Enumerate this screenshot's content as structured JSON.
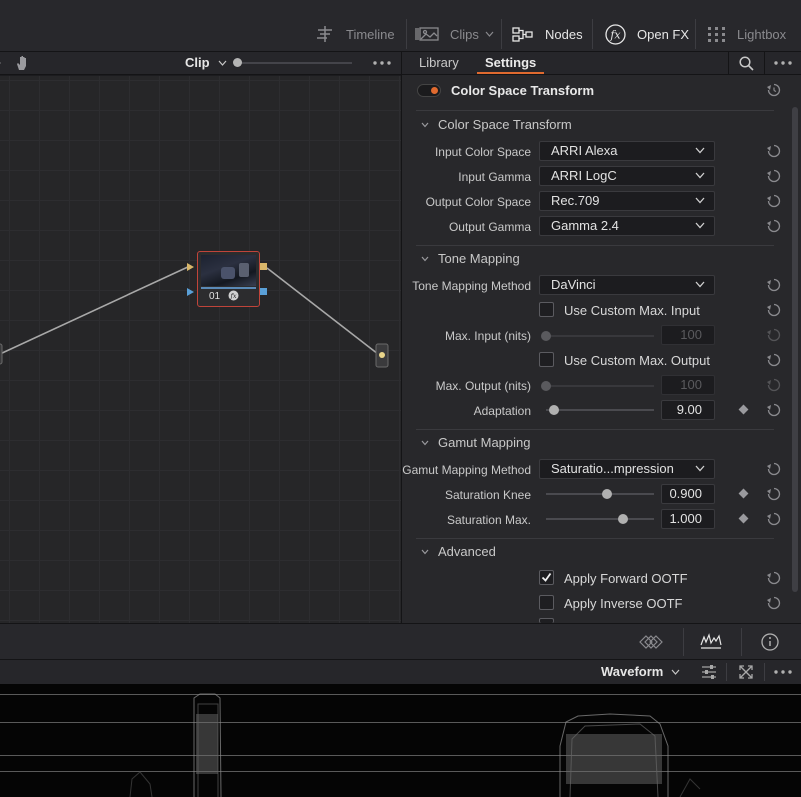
{
  "topbar": {
    "timeline_label": "Timeline",
    "clips_label": "Clips",
    "nodes_label": "Nodes",
    "openfx_label": "Open FX",
    "lightbox_label": "Lightbox"
  },
  "node_editor": {
    "mode_label": "Clip",
    "node_number": "01"
  },
  "panel": {
    "tabs": [
      "Library",
      "Settings"
    ],
    "active_tab": "Settings",
    "effect_title": "Color Space Transform",
    "sections": {
      "cst": "Color Space Transform",
      "tone": "Tone Mapping",
      "gamut": "Gamut Mapping",
      "advanced": "Advanced"
    },
    "input_color_space": {
      "label": "Input Color Space",
      "value": "ARRI Alexa"
    },
    "input_gamma": {
      "label": "Input Gamma",
      "value": "ARRI LogC"
    },
    "output_color_space": {
      "label": "Output Color Space",
      "value": "Rec.709"
    },
    "output_gamma": {
      "label": "Output Gamma",
      "value": "Gamma 2.4"
    },
    "tone_mapping_method": {
      "label": "Tone Mapping Method",
      "value": "DaVinci"
    },
    "use_custom_max_input": {
      "label": "Use Custom Max. Input",
      "checked": false
    },
    "max_input": {
      "label": "Max. Input (nits)",
      "value": "100",
      "level": 0.0
    },
    "use_custom_max_output": {
      "label": "Use Custom Max. Output",
      "checked": false
    },
    "max_output": {
      "label": "Max. Output (nits)",
      "value": "100",
      "level": 0.0
    },
    "adaptation": {
      "label": "Adaptation",
      "value": "9.00",
      "level": 0.09
    },
    "gamut_mapping_method": {
      "label": "Gamut Mapping Method",
      "value": "Saturatio...mpression"
    },
    "saturation_knee": {
      "label": "Saturation Knee",
      "value": "0.900",
      "level": 0.57
    },
    "saturation_max": {
      "label": "Saturation Max.",
      "value": "1.000",
      "level": 0.71
    },
    "apply_forward_ootf": {
      "label": "Apply Forward OOTF",
      "checked": true
    },
    "apply_inverse_ootf": {
      "label": "Apply Inverse OOTF",
      "checked": false
    }
  },
  "scope": {
    "mode_label": "Waveform"
  },
  "colors": {
    "accent": "#e06a2f",
    "node_border": "#c0443a"
  }
}
